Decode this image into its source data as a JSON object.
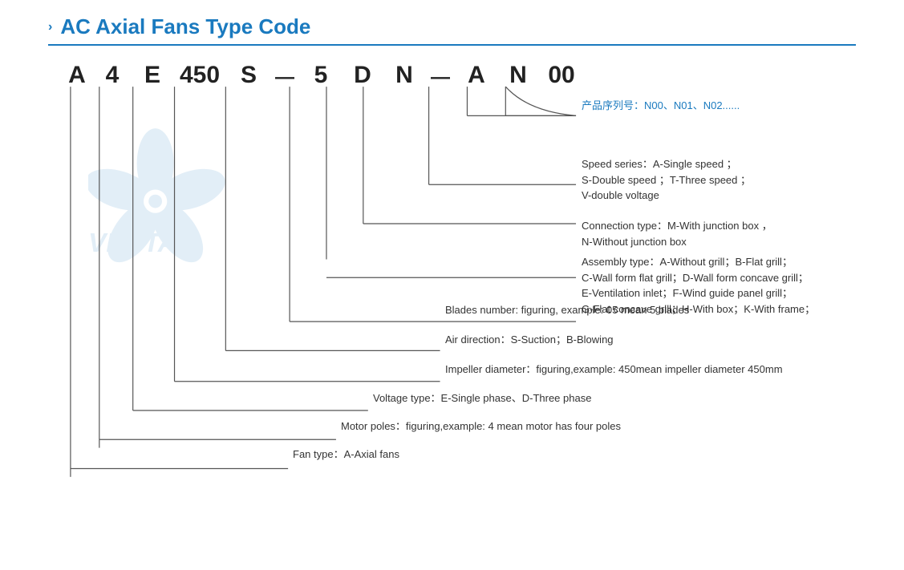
{
  "header": {
    "chevron": "›",
    "title": "AC Axial Fans Type Code"
  },
  "type_code": {
    "letters": [
      "A",
      "4",
      "E",
      "450",
      "S",
      "—",
      "5",
      "D",
      "N",
      "—",
      "A",
      "N",
      "00"
    ]
  },
  "annotations": {
    "product_series": {
      "label": "产品序列号：N00、N01、N02......"
    },
    "speed_series": {
      "label": "Speed series：A-Single speed ；",
      "line2": "S-Double speed ；T-Three speed ；",
      "line3": "V-double voltage"
    },
    "connection_type": {
      "label": "Connection type：M-With junction box ，",
      "line2": "N-Without junction box"
    },
    "assembly_type": {
      "label": "Assembly type：A-Without grill；B-Flat grill；",
      "line2": "C-Wall form flat grill；D-Wall form concave grill；",
      "line3": "E-Ventilation inlet；F-Wind guide panel grill；",
      "line4": "G-Flat concave grill；H-With box；K-With frame；"
    },
    "blades_number": {
      "label": "Blades number: figuring, example: 05 mean 5 blades"
    },
    "air_direction": {
      "label": "Air direction：S-Suction；B-Blowing"
    },
    "impeller_diameter": {
      "label": "Impeller diameter：figuring,example: 450mean impeller diameter 450mm"
    },
    "voltage_type": {
      "label": "Voltage type：E-Single phase、D-Three phase"
    },
    "motor_poles": {
      "label": "Motor poles：figuring,example: 4 mean motor has four poles"
    },
    "fan_type": {
      "label": "Fan type：A-Axial fans"
    }
  }
}
